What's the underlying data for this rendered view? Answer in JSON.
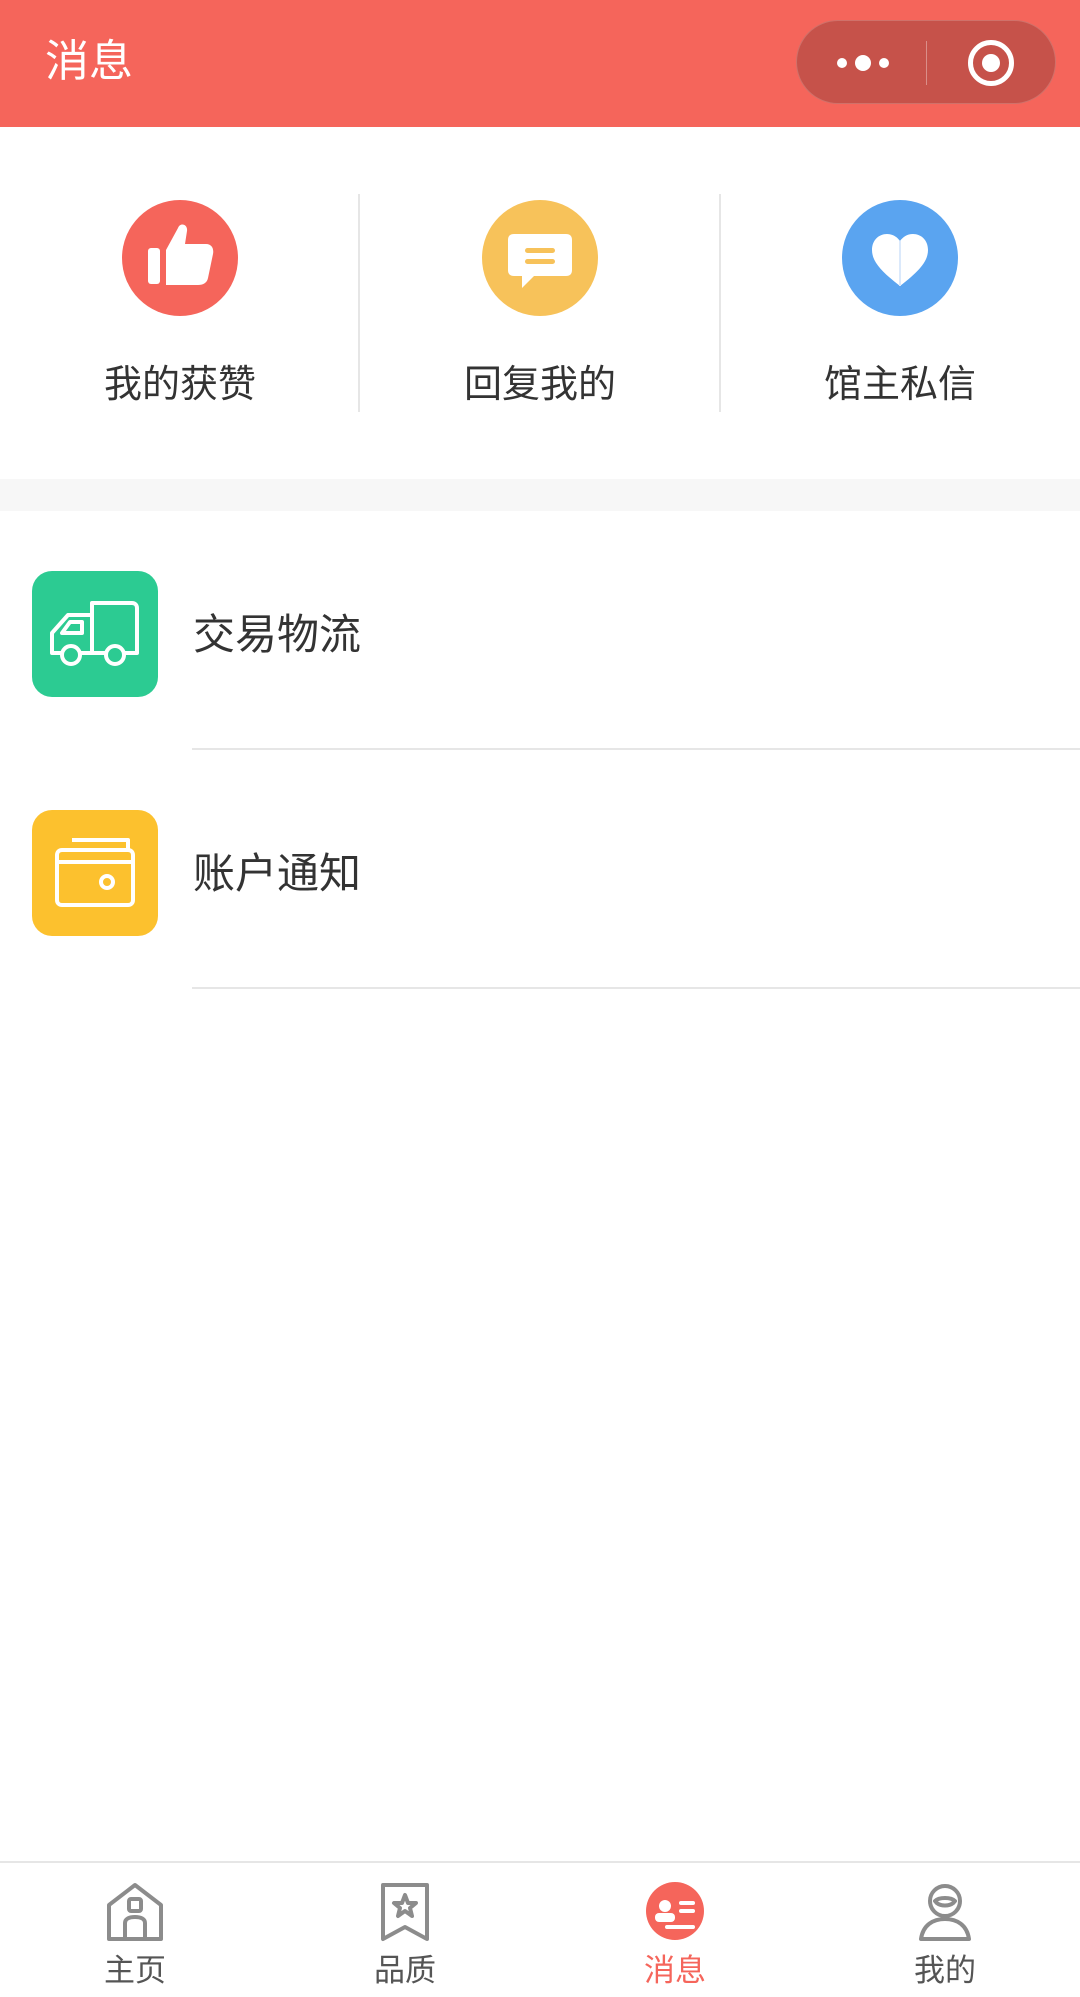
{
  "header": {
    "title": "消息",
    "background": "#f5655b",
    "capsule_more_icon": "more-dots-icon",
    "capsule_close_icon": "target-icon"
  },
  "quick_actions": [
    {
      "label": "我的获赞",
      "icon": "thumbs-up-icon",
      "color": "#f5655b"
    },
    {
      "label": "回复我的",
      "icon": "chat-bubble-icon",
      "color": "#f7c25a"
    },
    {
      "label": "馆主私信",
      "icon": "heart-icon",
      "color": "#5aa4f0"
    }
  ],
  "list": [
    {
      "label": "交易物流",
      "icon": "truck-icon",
      "color": "#2ccb92"
    },
    {
      "label": "账户通知",
      "icon": "wallet-icon",
      "color": "#fcc12e"
    }
  ],
  "tabbar": {
    "active_index": 2,
    "active_color": "#f5655b",
    "items": [
      {
        "label": "主页",
        "icon": "home-icon"
      },
      {
        "label": "品质",
        "icon": "bookmark-star-icon"
      },
      {
        "label": "消息",
        "icon": "message-icon"
      },
      {
        "label": "我的",
        "icon": "user-icon"
      }
    ]
  }
}
